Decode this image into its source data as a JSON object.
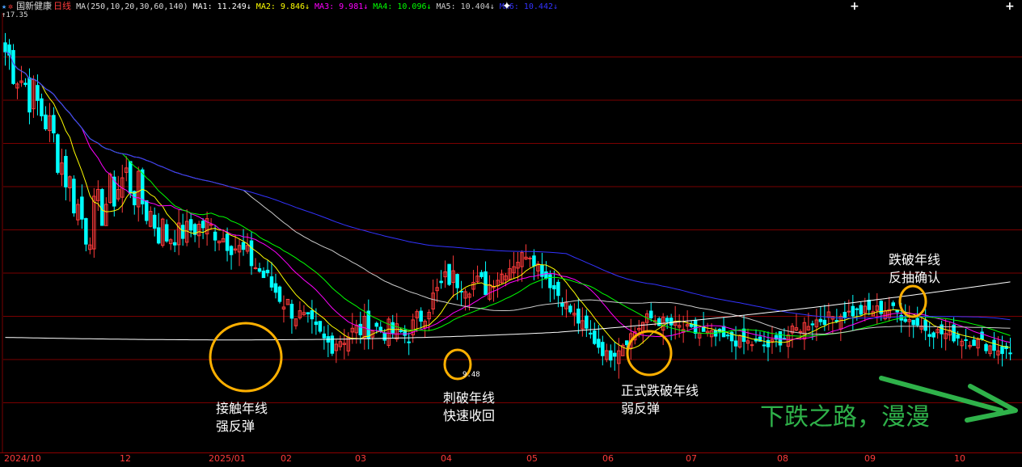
{
  "header": {
    "stock_name": "国新健康",
    "period": "日线",
    "ma_label": "MA(250,10,20,30,60,140)",
    "indicators": [
      {
        "label": "MA1: 11.249↓",
        "color": "#ffffff"
      },
      {
        "label": "MA2: 9.846↓",
        "color": "#ffff00"
      },
      {
        "label": "MA3: 9.981↓",
        "color": "#ff00ff"
      },
      {
        "label": "MA4: 10.096↓",
        "color": "#00ff00"
      },
      {
        "label": "MA5: 10.404↓",
        "color": "#cccccc"
      },
      {
        "label": "MA6: 10.442↓",
        "color": "#3333ff"
      }
    ]
  },
  "top_price_label": "↑17.35",
  "low_price_label": "9.48",
  "annotations": [
    {
      "id": "touch",
      "text": "接触年线\n强反弹"
    },
    {
      "id": "pierce",
      "text": "刺破年线\n快速收回"
    },
    {
      "id": "break",
      "text": "正式跌破年线\n弱反弹"
    },
    {
      "id": "retest",
      "text": "跌破年线\n反抽确认"
    }
  ],
  "slogan": "下跌之路，漫漫",
  "colors": {
    "up": "#ff3b3b",
    "down": "#00ffff",
    "grid": "#7a0000",
    "ma250": "#ffffff",
    "ma10": "#ffff00",
    "ma20": "#ff00ff",
    "ma30": "#00ff00",
    "ma60": "#cccccc",
    "ma140": "#3333ff",
    "circle": "#ffb000",
    "arrow": "#2fb24a"
  },
  "chart_data": {
    "type": "candlestick",
    "title": "国新健康 日线",
    "x_ticks": [
      "2024/10",
      "12",
      "2025/01",
      "02",
      "03",
      "04",
      "05",
      "06",
      "07",
      "08",
      "09",
      "10"
    ],
    "y_range": [
      7.6,
      17.35
    ],
    "gridlines": "horizontal",
    "price_path": [
      {
        "date": "2024/10",
        "price": 16.5
      },
      {
        "date": "2024/10",
        "price": 15.0
      },
      {
        "date": "2024/11",
        "price": 12.5
      },
      {
        "date": "2024/11",
        "price": 13.7
      },
      {
        "date": "2024/11",
        "price": 12.3
      },
      {
        "date": "2024/12",
        "price": 12.6
      },
      {
        "date": "2024/12",
        "price": 11.9
      },
      {
        "date": "2024/12",
        "price": 10.8
      },
      {
        "date": "2025/01",
        "price": 9.9
      },
      {
        "date": "2025/01",
        "price": 10.3
      },
      {
        "date": "2025/02",
        "price": 10.1
      },
      {
        "date": "2025/02",
        "price": 11.4
      },
      {
        "date": "2025/03",
        "price": 11.2
      },
      {
        "date": "2025/03",
        "price": 12.0
      },
      {
        "date": "2025/04",
        "price": 10.7
      },
      {
        "date": "2025/04",
        "price": 9.6
      },
      {
        "date": "2025/05",
        "price": 10.5
      },
      {
        "date": "2025/05",
        "price": 10.2
      },
      {
        "date": "2025/06",
        "price": 10.0
      },
      {
        "date": "2025/06",
        "price": 9.85
      },
      {
        "date": "2025/07",
        "price": 10.4
      },
      {
        "date": "2025/08",
        "price": 10.6
      },
      {
        "date": "2025/09",
        "price": 10.7
      },
      {
        "date": "2025/09",
        "price": 10.2
      },
      {
        "date": "2025/10",
        "price": 10.0
      },
      {
        "date": "2025/10",
        "price": 9.7
      }
    ],
    "series": [
      {
        "name": "MA1",
        "period": 250,
        "last": 11.249
      },
      {
        "name": "MA2",
        "period": 10,
        "last": 9.846
      },
      {
        "name": "MA3",
        "period": 20,
        "last": 9.981
      },
      {
        "name": "MA4",
        "period": 30,
        "last": 10.096
      },
      {
        "name": "MA5",
        "period": 60,
        "last": 10.404
      },
      {
        "name": "MA6",
        "period": 140,
        "last": 10.442
      }
    ]
  }
}
